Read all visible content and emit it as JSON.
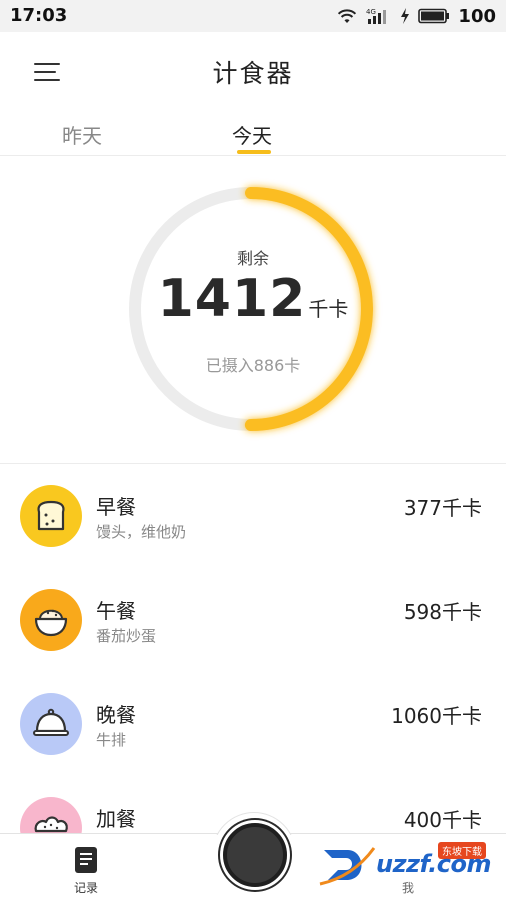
{
  "status_bar": {
    "time": "17:03",
    "network": "4G",
    "battery": "100"
  },
  "header": {
    "title": "计食器",
    "menu_icon": "menu-icon"
  },
  "tabs": [
    {
      "label": "昨天",
      "active": false
    },
    {
      "label": "今天",
      "active": true
    }
  ],
  "summary": {
    "remaining_label": "剩余",
    "remaining_value": "1412",
    "unit": "千卡",
    "intake_text": "已摄入886卡",
    "progress_fraction": 0.5,
    "ring_color": "#fbbd24",
    "track_color": "#ececec"
  },
  "meals": [
    {
      "name": "早餐",
      "foods": "馒头，维他奶",
      "kcal": "377千卡",
      "icon": "toast-icon",
      "color": "#f9c81f"
    },
    {
      "name": "午餐",
      "foods": "番茄炒蛋",
      "kcal": "598千卡",
      "icon": "bowl-icon",
      "color": "#f9a91b"
    },
    {
      "name": "晚餐",
      "foods": "牛排",
      "kcal": "1060千卡",
      "icon": "cloche-icon",
      "color": "#b9c9f7"
    },
    {
      "name": "加餐",
      "foods": "",
      "kcal": "400千卡",
      "icon": "cake-icon",
      "color": "#f8b6cc"
    }
  ],
  "bottom_nav": {
    "records_label": "记录",
    "me_label": "我",
    "records_icon": "notebook-icon",
    "center_icon": "record-button"
  },
  "watermark": {
    "text": "uzzf.com",
    "tag": "东坡下载"
  }
}
